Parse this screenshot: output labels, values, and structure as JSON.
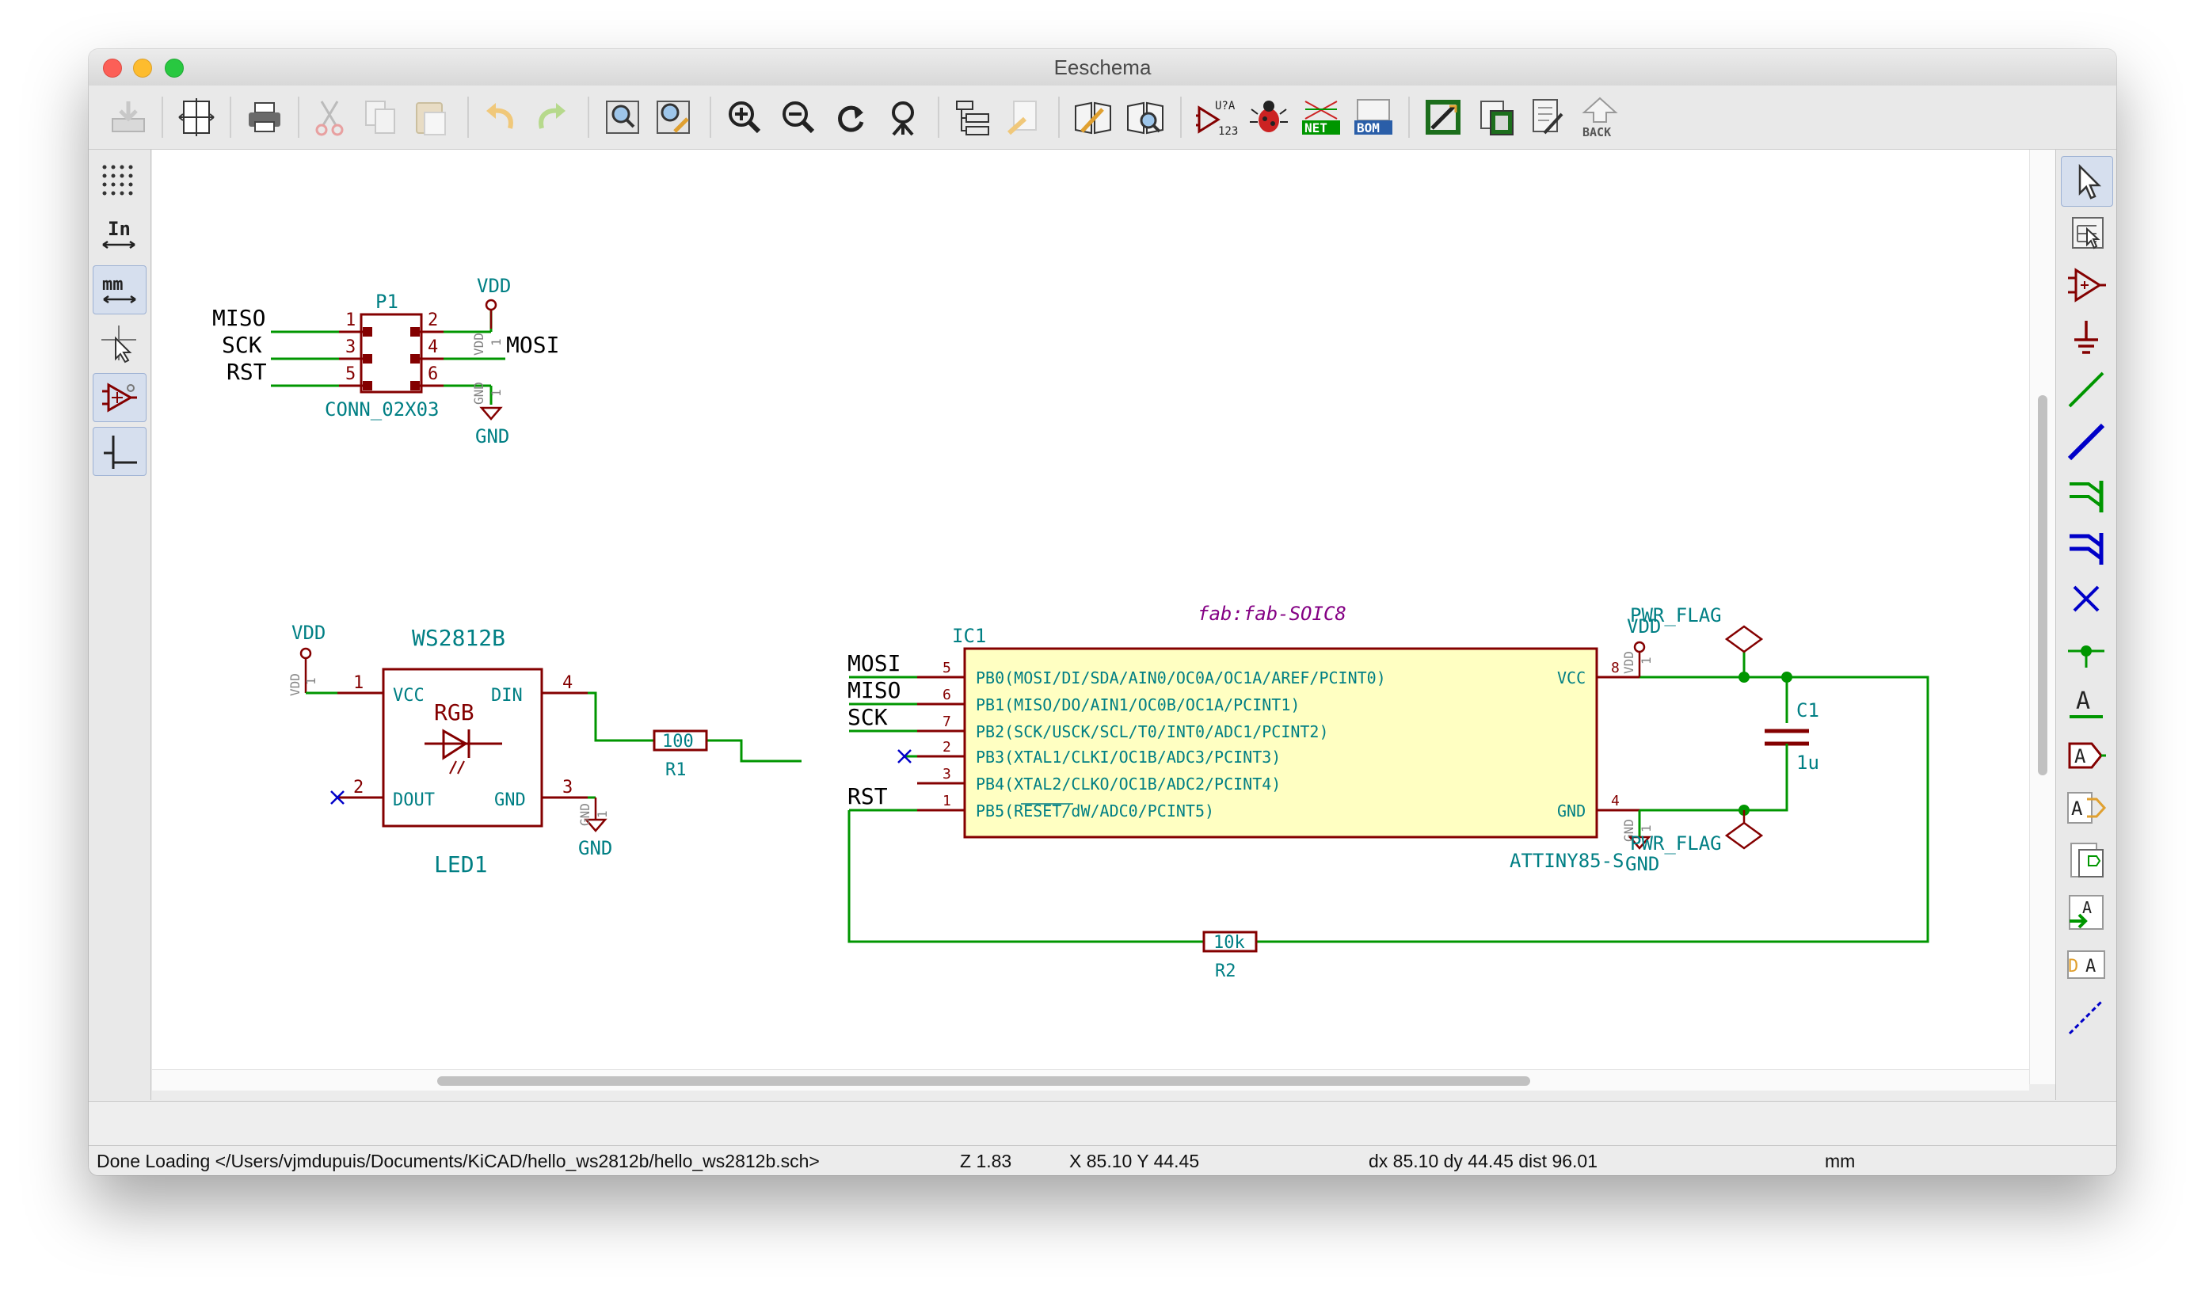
{
  "window": {
    "title": "Eeschema"
  },
  "toolbar": {
    "buttons": [
      "save-icon",
      "page-settings-icon",
      "print-icon",
      "cut-icon",
      "copy-icon",
      "paste-icon",
      "undo-icon",
      "redo-icon",
      "find-icon",
      "find-replace-icon",
      "zoom-in-icon",
      "zoom-out-icon",
      "redraw-icon",
      "zoom-fit-icon",
      "hierarchy-navigator-icon",
      "leave-sheet-icon",
      "library-editor-icon",
      "library-browser-icon",
      "annotate-icon",
      "erc-icon",
      "netlist-icon",
      "bom-icon",
      "cvpcb-icon",
      "pcbnew-icon",
      "import-footprints-icon",
      "back-annotate-icon"
    ],
    "annotate_label": "U?A",
    "annotate_sub": "123",
    "netlist_label": "NET",
    "bom_label": "BOM",
    "back_label": "BACK"
  },
  "left_toolbar": {
    "in_label": "In",
    "mm_label": "mm"
  },
  "right_toolbar": {
    "text_a": "A",
    "label_a": "A",
    "glabel_a": "A",
    "hlabel_a": "A",
    "import_a": "A",
    "sheet_pin_a": "A",
    "sheet_pin_d": "D"
  },
  "schematic": {
    "colors": {
      "wire": "#009600",
      "component": "#840000",
      "text": "#007f84",
      "body_fill": "#ffffc2",
      "noconnect": "#0000c8",
      "label": "#000000",
      "footprint": "#840084",
      "hidden": "#848484"
    },
    "connector": {
      "ref": "P1",
      "value": "CONN_02X03",
      "labels_left": [
        "MISO",
        "SCK",
        "RST"
      ],
      "pins_left": [
        "1",
        "3",
        "5"
      ],
      "pins_right": [
        "2",
        "4",
        "6"
      ],
      "label_right": "MOSI",
      "vdd": "VDD",
      "gnd": "GND",
      "vdd_hidden": "VDD",
      "gnd_hidden": "GND",
      "pin1": "1"
    },
    "led": {
      "title": "WS2812B",
      "ref": "LED1",
      "center": "RGB",
      "vcc": "VCC",
      "din": "DIN",
      "dout": "DOUT",
      "gnd": "GND",
      "pin_vcc": "1",
      "pin_din": "4",
      "pin_dout": "2",
      "pin_gnd": "3",
      "vdd": "VDD",
      "gnd_label": "GND",
      "vdd_hidden": "VDD",
      "gnd_hidden": "GND",
      "pin1": "1"
    },
    "r1": {
      "value": "100",
      "ref": "R1"
    },
    "r2": {
      "value": "10k",
      "ref": "R2"
    },
    "ic": {
      "ref": "IC1",
      "value": "ATTINY85-S",
      "footprint": "fab:fab-SOIC8",
      "pins": [
        {
          "num": "5",
          "name": "PB0(MOSI/DI/SDA/AIN0/OC0A/OC1A/AREF/PCINT0)"
        },
        {
          "num": "6",
          "name": "PB1(MISO/DO/AIN1/OC0B/OC1A/PCINT1)"
        },
        {
          "num": "7",
          "name": "PB2(SCK/USCK/SCL/T0/INT0/ADC1/PCINT2)"
        },
        {
          "num": "2",
          "name": "PB3(XTAL1/CLKI/OC1B/ADC3/PCINT3)"
        },
        {
          "num": "3",
          "name": "PB4(XTAL2/CLKO/OC1B/ADC2/PCINT4)"
        },
        {
          "num": "1",
          "name": "PB5(RESET/dW/ADC0/PCINT5)"
        }
      ],
      "vcc": "VCC",
      "gnd": "GND",
      "pin_vcc": "8",
      "pin_gnd": "4",
      "labels": [
        "MOSI",
        "MISO",
        "SCK",
        "RST"
      ]
    },
    "c1": {
      "ref": "C1",
      "value": "1u"
    },
    "power": {
      "vdd": "VDD",
      "gnd": "GND",
      "pwr_flag_top": "PWR_FLAG",
      "pwr_flag_bottom": "PWR_FLAG",
      "vdd_hidden": "VDD",
      "gnd_hidden": "GND",
      "pin1": "1"
    }
  },
  "status": {
    "message": "Done Loading </Users/vjmdupuis/Documents/KiCAD/hello_ws2812b/hello_ws2812b.sch>",
    "zoom": "Z 1.83",
    "xy": "X 85.10  Y 44.45",
    "delta": "dx 85.10  dy 44.45  dist 96.01",
    "units": "mm"
  }
}
